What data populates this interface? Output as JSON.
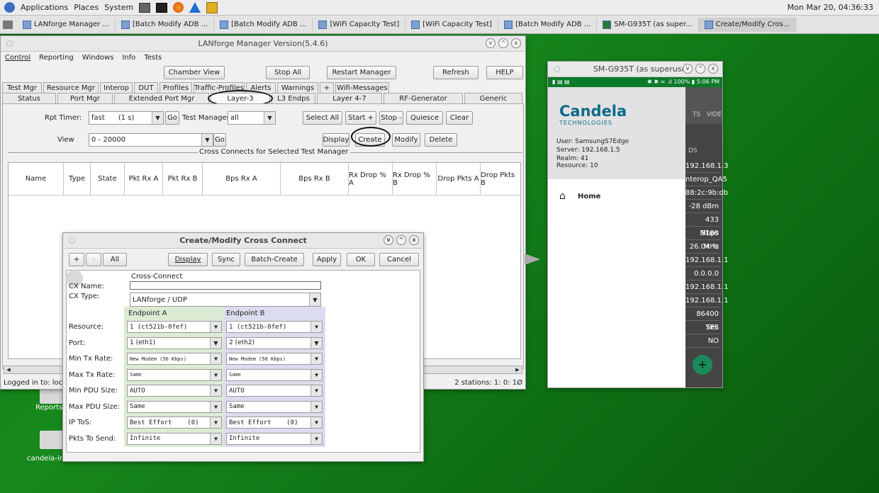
{
  "top_panel": {
    "menu": [
      "Applications",
      "Places",
      "System"
    ],
    "clock": "Mon Mar 20, 04:36:33"
  },
  "taskbar": [
    "LANforge Manager ...",
    "[Batch Modify ADB ...",
    "[Batch Modify ADB ...",
    "[WiFi Capacity Test]",
    "[WiFi Capacity Test]",
    "[Batch Modify ADB ...",
    "SM-G935T (as super...",
    "Create/Modify Cros..."
  ],
  "desktop": {
    "icon1": "Reports",
    "icon2": "candela-ins..."
  },
  "manager": {
    "title": "LANforge Manager   Version(5.4.6)",
    "menu": [
      "Control",
      "Reporting",
      "Windows",
      "Info",
      "Tests"
    ],
    "top_buttons": {
      "chamber": "Chamber View",
      "stopall": "Stop All",
      "restart": "Restart Manager",
      "refresh": "Refresh",
      "help": "HELP"
    },
    "tabs_row1": [
      "Test Mgr",
      "Resource Mgr",
      "Interop",
      "DUT",
      "Profiles",
      "Traffic-Profiles",
      "Alerts",
      "Warnings",
      "+",
      "Wifi-Messages"
    ],
    "tabs_row2": [
      "Status",
      "Port Mgr",
      "Extended Port Mgr",
      "Layer-3",
      "L3 Endps",
      "Layer 4-7",
      "RF-Generator",
      "Generic"
    ],
    "rpt_timer_label": "Rpt Timer:",
    "rpt_timer_value": "fast      (1 s)",
    "go": "Go",
    "test_manager_label": "Test Manager",
    "test_manager_value": "all",
    "select_all": "Select All",
    "start": "Start +",
    "stop": "Stop -",
    "quiesce": "Quiesce",
    "clear": "Clear",
    "view_label": "View",
    "view_value": "0 - 20000",
    "display": "Display",
    "create": "Create",
    "modify": "Modify",
    "delete": "Delete",
    "group_title": "Cross Connects for Selected Test Manager",
    "columns": [
      "Name",
      "Type",
      "State",
      "Pkt Rx A",
      "Pkt Rx B",
      "Bps Rx A",
      "Bps Rx B",
      "Rx Drop % A",
      "Rx Drop % B",
      "Drop Pkts A",
      "Drop Pkts B"
    ],
    "status_left": "Logged in to:  localh",
    "status_right": "2 stations: 1: 0: 1Ø"
  },
  "phone": {
    "title": "SM-G935T (as superuser)",
    "statusbar": "✱ ✖ ≈ .ıl 100% ▮ 5:06 PM",
    "brand": "Candela",
    "brand_sub": "TECHNOLOGIES",
    "user": "User: SamsungS7Edge",
    "server": "Server: 192.168.1.5",
    "realm": "Realm: 41",
    "resource": "Resource: 10",
    "home": "Home",
    "tabs_right": "TS   VIDE",
    "ds": "DS",
    "right_values": [
      "192.168.1.3",
      "nterop_QA5",
      "88:2c:9b:db",
      "-28 dBm",
      "433 Mbps",
      "5180 MHz",
      "26.04 %",
      "192.168.1.1",
      "0.0.0.0",
      "192.168.1.1",
      "192.168.1.1",
      "86400 Sec",
      "YES",
      "NO"
    ],
    "fab": "+"
  },
  "dialog": {
    "title": "Create/Modify Cross Connect",
    "buttons": {
      "plus": "+",
      "minus": "-",
      "all": "All",
      "display": "Display",
      "sync": "Sync",
      "batch": "Batch-Create",
      "apply": "Apply",
      "ok": "OK",
      "cancel": "Cancel"
    },
    "cross_connect_label": "Cross-Connect",
    "cx_name_label": "CX Name:",
    "cx_name_value": "",
    "cx_type_label": "CX Type:",
    "cx_type_value": "LANforge / UDP",
    "endpoint_a": "Endpoint A",
    "endpoint_b": "Endpoint B",
    "rows": [
      {
        "label": "Resource:",
        "a": "1 (ct521b-0fef)",
        "b": "1 (ct521b-0fef)"
      },
      {
        "label": "Port:",
        "a": "1 (eth1)",
        "b": "2 (eth2)"
      },
      {
        "label": "Min Tx Rate:",
        "a": "New Modem (56 Kbps)",
        "b": "New Modem (56 Kbps)"
      },
      {
        "label": "Max Tx Rate:",
        "a": "Same",
        "b": "Same"
      },
      {
        "label": "Min PDU Size:",
        "a": "AUTO",
        "b": "AUTO"
      },
      {
        "label": "Max PDU Size:",
        "a": "Same",
        "b": "Same"
      },
      {
        "label": "IP ToS:",
        "a": "Best Effort    (0)",
        "b": "Best Effort    (0)"
      },
      {
        "label": "Pkts To Send:",
        "a": "Infinite",
        "b": "Infinite"
      }
    ]
  }
}
